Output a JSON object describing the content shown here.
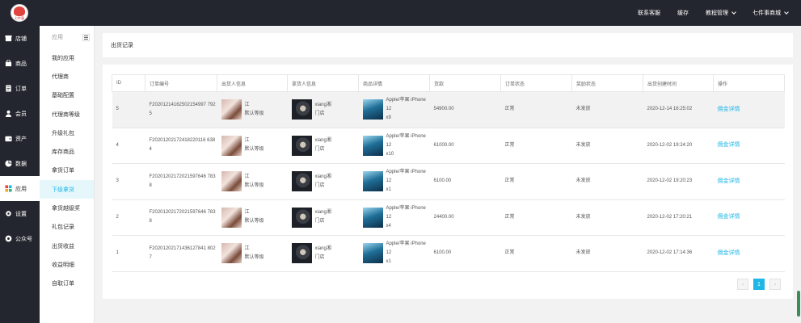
{
  "brand": {
    "logo_text": "七件事"
  },
  "topnav": {
    "items": [
      {
        "label": "联系客服",
        "has_dropdown": false
      },
      {
        "label": "缓存",
        "has_dropdown": false
      },
      {
        "label": "教程管理",
        "has_dropdown": true
      },
      {
        "label": "七件事商城",
        "has_dropdown": true
      }
    ]
  },
  "sidebar": {
    "items": [
      {
        "label": "店铺",
        "icon": "store-icon",
        "active": false
      },
      {
        "label": "商品",
        "icon": "goods-icon",
        "active": false
      },
      {
        "label": "订单",
        "icon": "order-icon",
        "active": false
      },
      {
        "label": "会员",
        "icon": "member-icon",
        "active": false
      },
      {
        "label": "资产",
        "icon": "wallet-icon",
        "active": false
      },
      {
        "label": "数据",
        "icon": "data-icon",
        "active": false
      },
      {
        "label": "应用",
        "icon": "apps-icon",
        "active": true
      },
      {
        "label": "设置",
        "icon": "gear-icon",
        "active": false
      },
      {
        "label": "公众号",
        "icon": "official-account-icon",
        "active": false
      }
    ]
  },
  "subnav": {
    "title": "应用",
    "items": [
      {
        "label": "我的应用",
        "active": false
      },
      {
        "label": "代理商",
        "active": false
      },
      {
        "label": "基础配置",
        "active": false
      },
      {
        "label": "代理商等级",
        "active": false
      },
      {
        "label": "升级礼包",
        "active": false
      },
      {
        "label": "库存商品",
        "active": false
      },
      {
        "label": "拿货订单",
        "active": false
      },
      {
        "label": "下级拿货",
        "active": true
      },
      {
        "label": "拿货越级奖",
        "active": false
      },
      {
        "label": "礼包记录",
        "active": false
      },
      {
        "label": "出货收益",
        "active": false
      },
      {
        "label": "收益明细",
        "active": false
      },
      {
        "label": "自取订单",
        "active": false
      }
    ]
  },
  "page": {
    "title": "出货记录"
  },
  "table": {
    "headers": [
      "ID",
      "订单编号",
      "出货人信息",
      "拿货人信息",
      "商品详情",
      "货款",
      "订单状态",
      "奖励状态",
      "出货创建时间",
      "操作"
    ],
    "rows": [
      {
        "id": "5",
        "order_no": "F20201214162502154997 7925",
        "seller_name": "江",
        "seller_level": "默认等级",
        "buyer_name": "xiang湘",
        "buyer_store": "门店",
        "product_name": "Apple/苹果 iPhone 12",
        "product_qty": "x9",
        "amount": "54900.00",
        "order_status": "正常",
        "reward_status": "未发放",
        "created": "2020-12-14 16:25:02",
        "action": "佣金详情",
        "highlight": true
      },
      {
        "id": "4",
        "order_no": "F20201202172418220116 6384",
        "seller_name": "江",
        "seller_level": "默认等级",
        "buyer_name": "xiang湘",
        "buyer_store": "门店",
        "product_name": "Apple/苹果 iPhone 12",
        "product_qty": "x10",
        "amount": "61000.00",
        "order_status": "正常",
        "reward_status": "未发放",
        "created": "2020-12-02 19:24:20",
        "action": "佣金详情",
        "highlight": false
      },
      {
        "id": "3",
        "order_no": "F20201202172021597646 7838",
        "seller_name": "江",
        "seller_level": "默认等级",
        "buyer_name": "xiang湘",
        "buyer_store": "门店",
        "product_name": "Apple/苹果 iPhone 12",
        "product_qty": "x1",
        "amount": "6100.00",
        "order_status": "正常",
        "reward_status": "未发放",
        "created": "2020-12-02 19:20:23",
        "action": "佣金详情",
        "highlight": false
      },
      {
        "id": "2",
        "order_no": "F20201202172021597646 7838",
        "seller_name": "江",
        "seller_level": "默认等级",
        "buyer_name": "xiang湘",
        "buyer_store": "门店",
        "product_name": "Apple/苹果 iPhone 12",
        "product_qty": "x4",
        "amount": "24400.00",
        "order_status": "正常",
        "reward_status": "未发放",
        "created": "2020-12-02 17:20:21",
        "action": "佣金详情",
        "highlight": false
      },
      {
        "id": "1",
        "order_no": "F20201202171436127841 8027",
        "seller_name": "江",
        "seller_level": "默认等级",
        "buyer_name": "xiang湘",
        "buyer_store": "门店",
        "product_name": "Apple/苹果 iPhone 12",
        "product_qty": "x1",
        "amount": "6100.00",
        "order_status": "正常",
        "reward_status": "未发放",
        "created": "2020-12-02 17:14:36",
        "action": "佣金详情",
        "highlight": false
      }
    ]
  },
  "pagination": {
    "prev": "‹",
    "current": "1",
    "next": "›"
  },
  "colors": {
    "accent": "#1eb7e6",
    "nav_bg": "#23262e",
    "row_highlight": "#f2f2f2"
  }
}
